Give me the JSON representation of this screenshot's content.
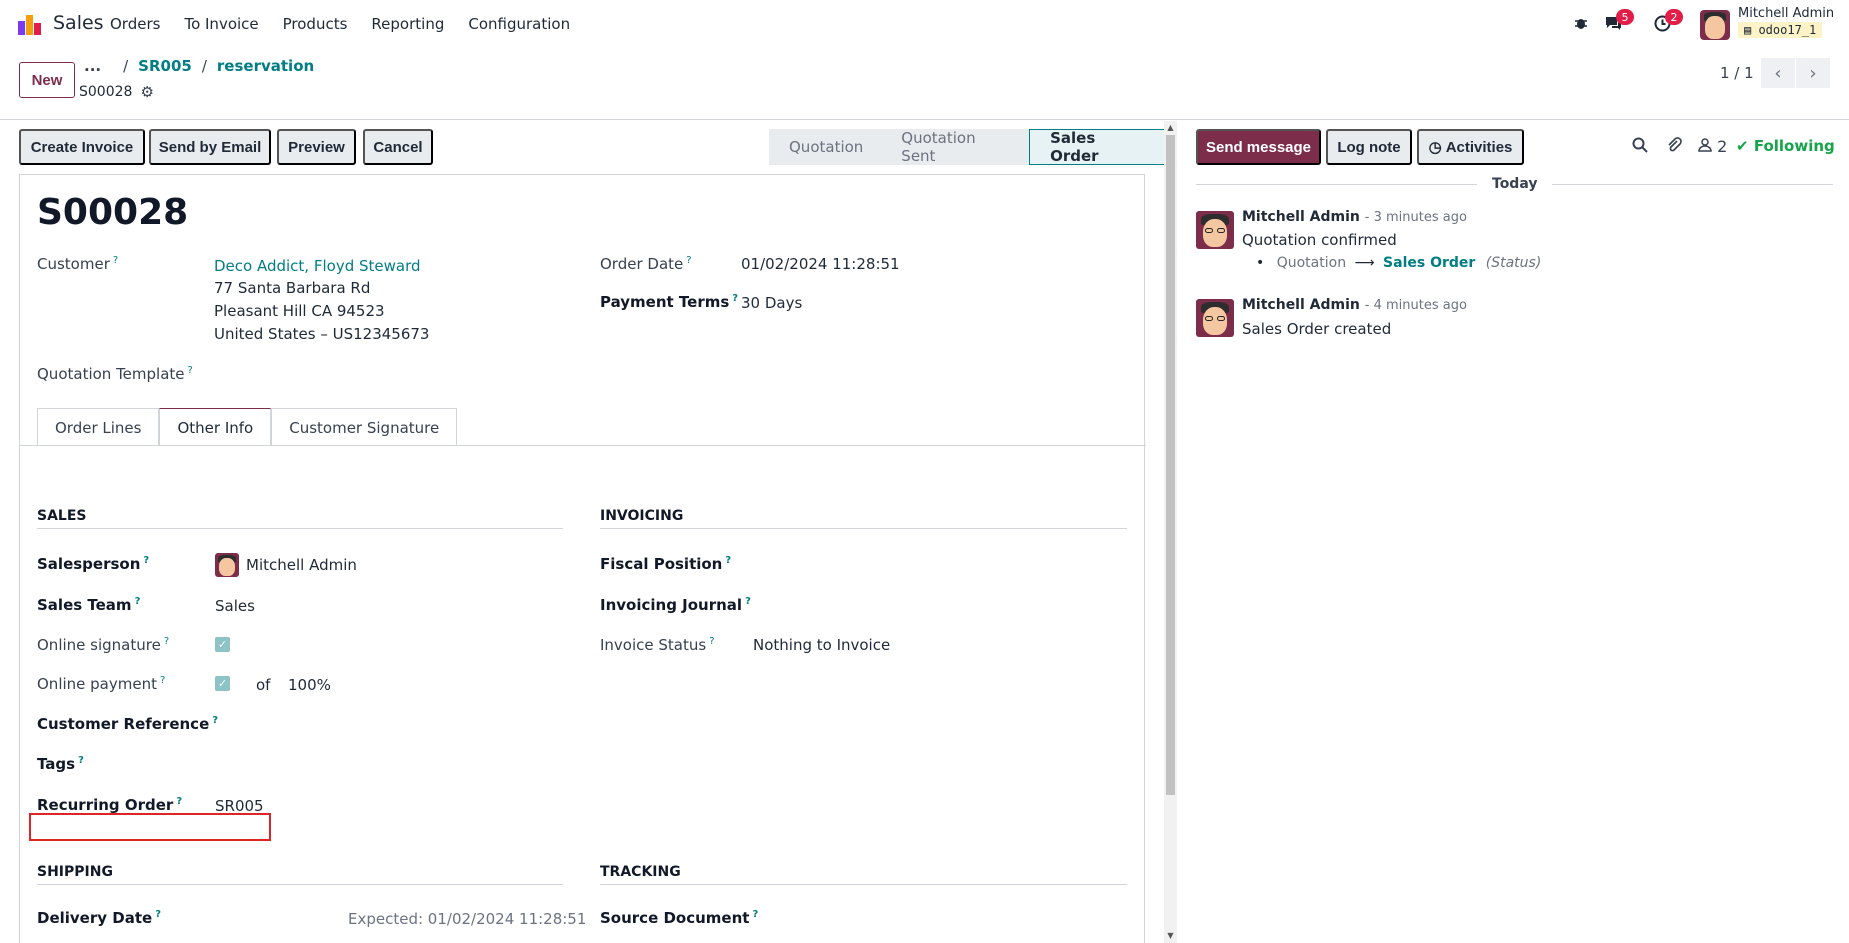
{
  "navbar": {
    "app_name": "Sales",
    "menu": [
      "Orders",
      "To Invoice",
      "Products",
      "Reporting",
      "Configuration"
    ],
    "messages_badge": "5",
    "activities_badge": "2",
    "user_name": "Mitchell Admin",
    "db_name": "odoo17_1"
  },
  "control_panel": {
    "new_label": "New",
    "breadcrumb_dots": "...",
    "breadcrumb": [
      "SR005",
      "reservation"
    ],
    "record_title": "S00028",
    "pager": "1 / 1"
  },
  "actions": {
    "create_invoice": "Create Invoice",
    "send_email": "Send by Email",
    "preview": "Preview",
    "cancel": "Cancel"
  },
  "statusbar": [
    "Quotation",
    "Quotation Sent",
    "Sales Order"
  ],
  "statusbar_active": "Sales Order",
  "form": {
    "name": "S00028",
    "customer_label": "Customer",
    "customer_name": "Deco Addict, Floyd Steward",
    "address_1": "77 Santa Barbara Rd",
    "address_2": "Pleasant Hill CA 94523",
    "address_3": "United States – US12345673",
    "quotation_template_label": "Quotation Template",
    "order_date_label": "Order Date",
    "order_date": "01/02/2024 11:28:51",
    "payment_terms_label": "Payment Terms",
    "payment_terms": "30 Days",
    "help_mark": "?"
  },
  "tabs": [
    "Order Lines",
    "Other Info",
    "Customer Signature"
  ],
  "other_info": {
    "sales_header": "SALES",
    "salesperson_label": "Salesperson",
    "salesperson": "Mitchell Admin",
    "sales_team_label": "Sales Team",
    "sales_team": "Sales",
    "online_signature_label": "Online signature",
    "online_payment_label": "Online payment",
    "online_payment_of": "of",
    "online_payment_pct": "100%",
    "customer_reference_label": "Customer Reference",
    "tags_label": "Tags",
    "recurring_order_label": "Recurring Order",
    "recurring_order": "SR005",
    "invoicing_header": "INVOICING",
    "fiscal_position_label": "Fiscal Position",
    "invoicing_journal_label": "Invoicing Journal",
    "invoice_status_label": "Invoice Status",
    "invoice_status": "Nothing to Invoice",
    "shipping_header": "SHIPPING",
    "delivery_date_label": "Delivery Date",
    "delivery_expected": "Expected: 01/02/2024 11:28:51",
    "tracking_header": "TRACKING",
    "source_document_label": "Source Document"
  },
  "chatter": {
    "send_message": "Send message",
    "log_note": "Log note",
    "activities": "Activities",
    "followers_count": "2",
    "following": "Following",
    "today": "Today",
    "messages": [
      {
        "author": "Mitchell Admin",
        "time": "- 3 minutes ago",
        "body": "Quotation confirmed",
        "tracking_from": "Quotation",
        "tracking_to": "Sales Order",
        "tracking_field": "(Status)"
      },
      {
        "author": "Mitchell Admin",
        "time": "- 4 minutes ago",
        "body": "Sales Order created"
      }
    ]
  },
  "colors": {
    "brand": "#7c2d4a",
    "link": "#017e84",
    "badge": "#e11d48",
    "following": "#16a34a",
    "highlight": "#dc2626"
  }
}
